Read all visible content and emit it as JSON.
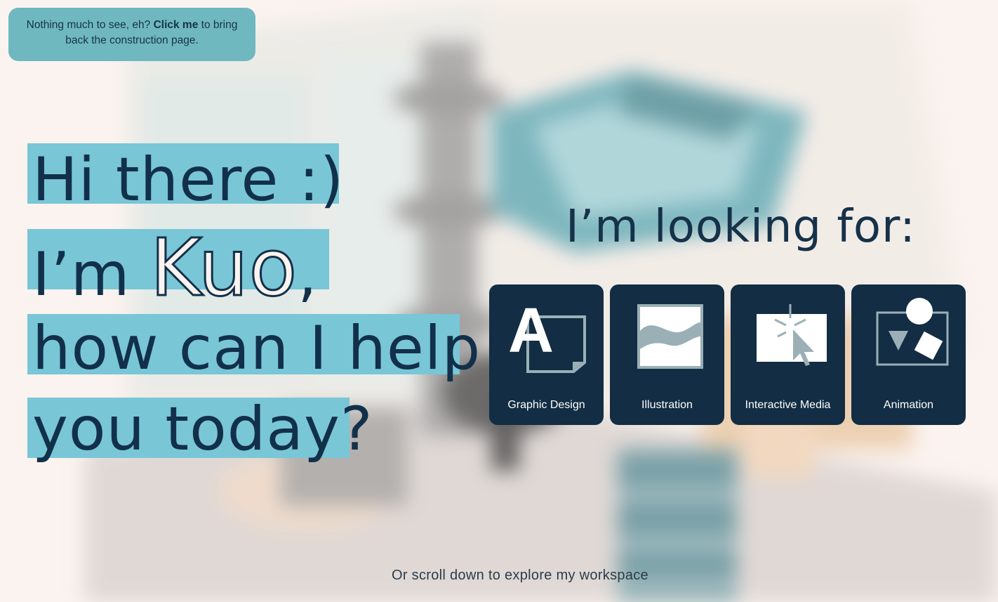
{
  "notice": {
    "text_before": "Nothing much to see, eh? ",
    "link": "Click me",
    "text_after": " to bring back the construction page."
  },
  "greeting": {
    "line1": "Hi there :)",
    "line2_prefix": "I’m ",
    "line2_name": "Kuo",
    "line2_suffix": ",",
    "line3": "how can I help",
    "line4": "you today?"
  },
  "looking_for": {
    "heading": "I’m looking for:",
    "cards": [
      {
        "label": "Graphic Design",
        "icon": "graphic-design-icon"
      },
      {
        "label": "Illustration",
        "icon": "illustration-icon"
      },
      {
        "label": "Interactive Media",
        "icon": "interactive-media-icon"
      },
      {
        "label": "Animation",
        "icon": "animation-icon"
      }
    ]
  },
  "scroll_hint": "Or scroll down to explore my workspace",
  "colors": {
    "background": "#fbf3ef",
    "highlight": "#79c6d6",
    "card": "#122d44",
    "notice": "#6fb8c0",
    "text": "#12304a"
  }
}
